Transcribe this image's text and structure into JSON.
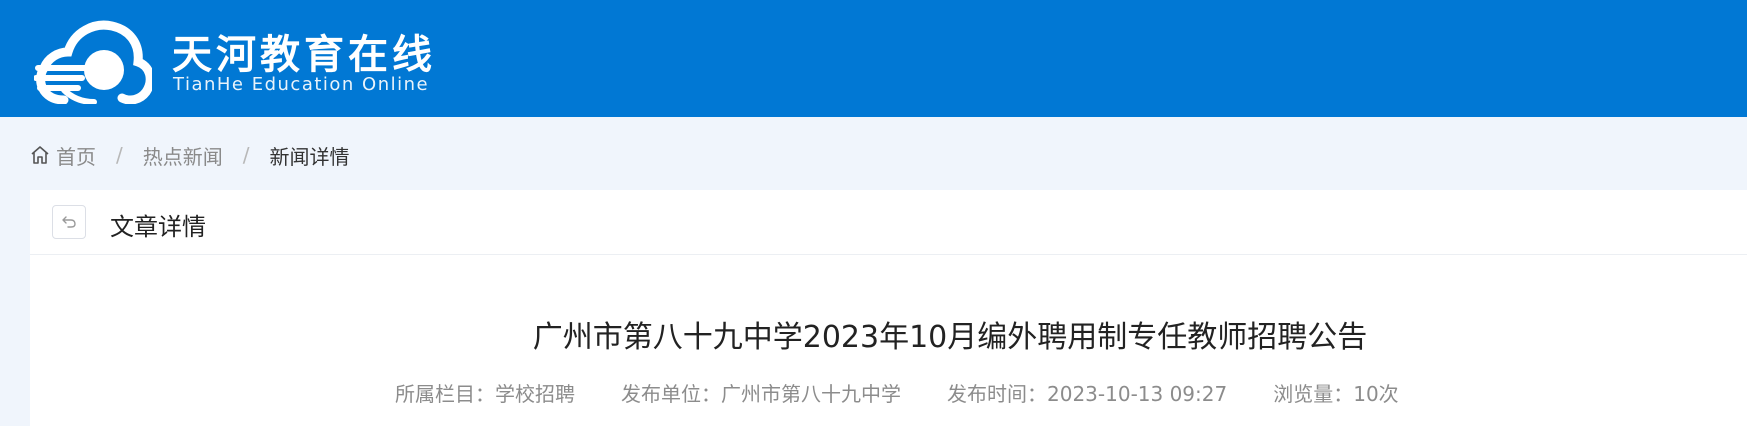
{
  "header": {
    "brand_cn": "天河教育在线",
    "brand_en": "TianHe Education Online",
    "bg_color": "#0178d4"
  },
  "breadcrumb": {
    "home_icon": "home-icon",
    "items": [
      "首页",
      "热点新闻",
      "新闻详情"
    ]
  },
  "card": {
    "back_icon": "back-arrow-icon",
    "title": "文章详情"
  },
  "article": {
    "title": "广州市第八十九中学2023年10月编外聘用制专任教师招聘公告",
    "meta": {
      "category": "所属栏目：学校招聘",
      "publisher": "发布单位：广州市第八十九中学",
      "publish_time": "发布时间：2023-10-13 09:27",
      "views": "浏览量：10次"
    }
  }
}
